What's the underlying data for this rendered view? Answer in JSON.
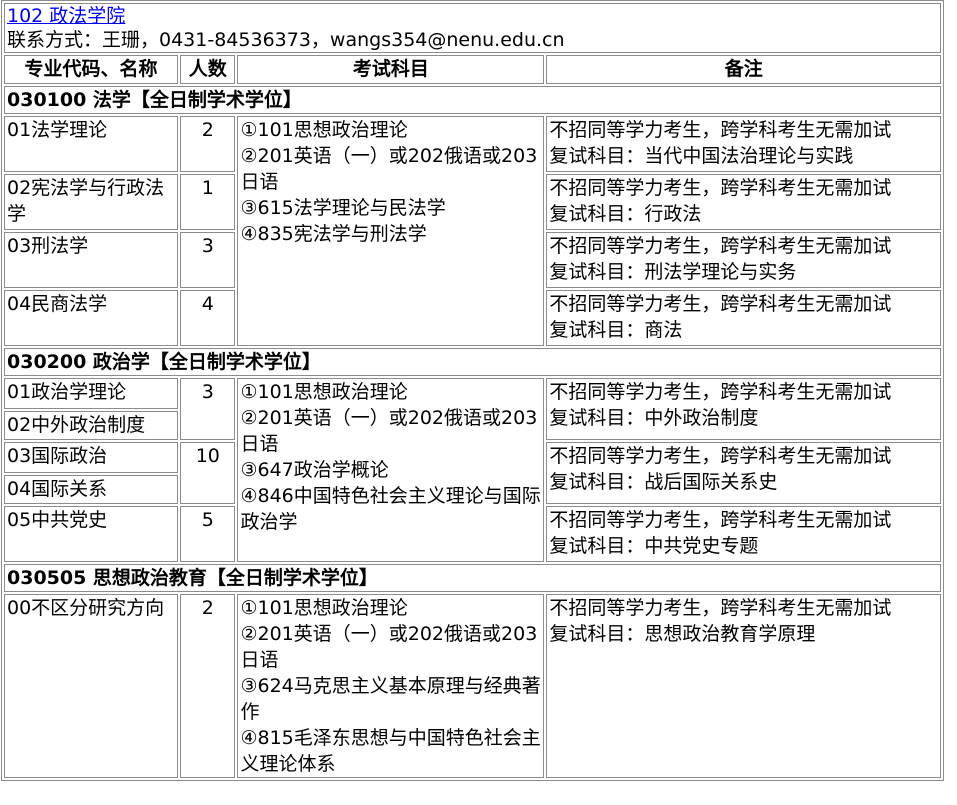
{
  "header": {
    "college_link": "102 政法学院",
    "contact": "联系方式：王珊，0431-84536373，wangs354@nenu.edu.cn"
  },
  "columns": [
    "专业代码、名称",
    "人数",
    "考试科目",
    "备注"
  ],
  "sections": [
    {
      "title": "030100 法学【全日制学术学位】",
      "rows": [
        {
          "name": "01法学理论",
          "count": "2",
          "remark1": "不招同等学力考生，跨学科考生无需加试",
          "remark2": "复试科目：当代中国法治理论与实践"
        },
        {
          "name": "02宪法学与行政法学",
          "count": "1",
          "remark1": "不招同等学力考生，跨学科考生无需加试",
          "remark2": "复试科目：行政法"
        },
        {
          "name": "03刑法学",
          "count": "3",
          "remark1": "不招同等学力考生，跨学科考生无需加试",
          "remark2": "复试科目：刑法学理论与实务"
        },
        {
          "name": "04民商法学",
          "count": "4",
          "remark1": "不招同等学力考生，跨学科考生无需加试",
          "remark2": "复试科目：商法"
        }
      ],
      "subjects": [
        "①101思想政治理论",
        "②201英语（一）或202俄语或203日语",
        "③615法学理论与民法学",
        "④835宪法学与刑法学"
      ]
    },
    {
      "title": "030200 政治学【全日制学术学位】",
      "names": [
        "01政治学理论",
        "02中外政治制度",
        "03国际政治",
        "04国际关系",
        "05中共党史"
      ],
      "counts": [
        "3",
        "10",
        "5"
      ],
      "subjects": [
        "①101思想政治理论",
        "②201英语（一）或202俄语或203日语",
        "③647政治学概论",
        "④846中国特色社会主义理论与国际政治学"
      ],
      "remarks": [
        {
          "remark1": "不招同等学力考生，跨学科考生无需加试",
          "remark2": "复试科目：中外政治制度"
        },
        {
          "remark1": "不招同等学力考生，跨学科考生无需加试",
          "remark2": "复试科目：战后国际关系史"
        },
        {
          "remark1": "不招同等学力考生，跨学科考生无需加试",
          "remark2": "复试科目：中共党史专题"
        }
      ]
    },
    {
      "title": "030505 思想政治教育【全日制学术学位】",
      "rows": [
        {
          "name": "00不区分研究方向",
          "count": "2",
          "remark1": "不招同等学力考生，跨学科考生无需加试",
          "remark2": "复试科目：思想政治教育学原理"
        }
      ],
      "subjects": [
        "①101思想政治理论",
        "②201英语（一）或202俄语或203日语",
        "③624马克思主义基本原理与经典著作",
        "④815毛泽东思想与中国特色社会主义理论体系"
      ]
    }
  ]
}
